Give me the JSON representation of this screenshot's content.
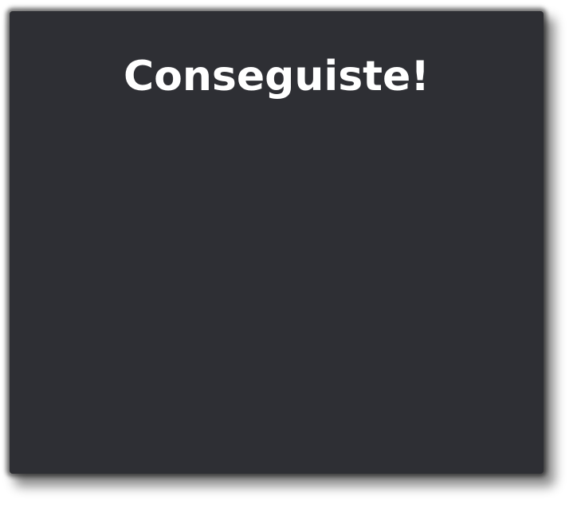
{
  "dialog": {
    "title": "Conseguiste!",
    "background_color": "#2e2f34",
    "title_color": "#ffffff"
  }
}
